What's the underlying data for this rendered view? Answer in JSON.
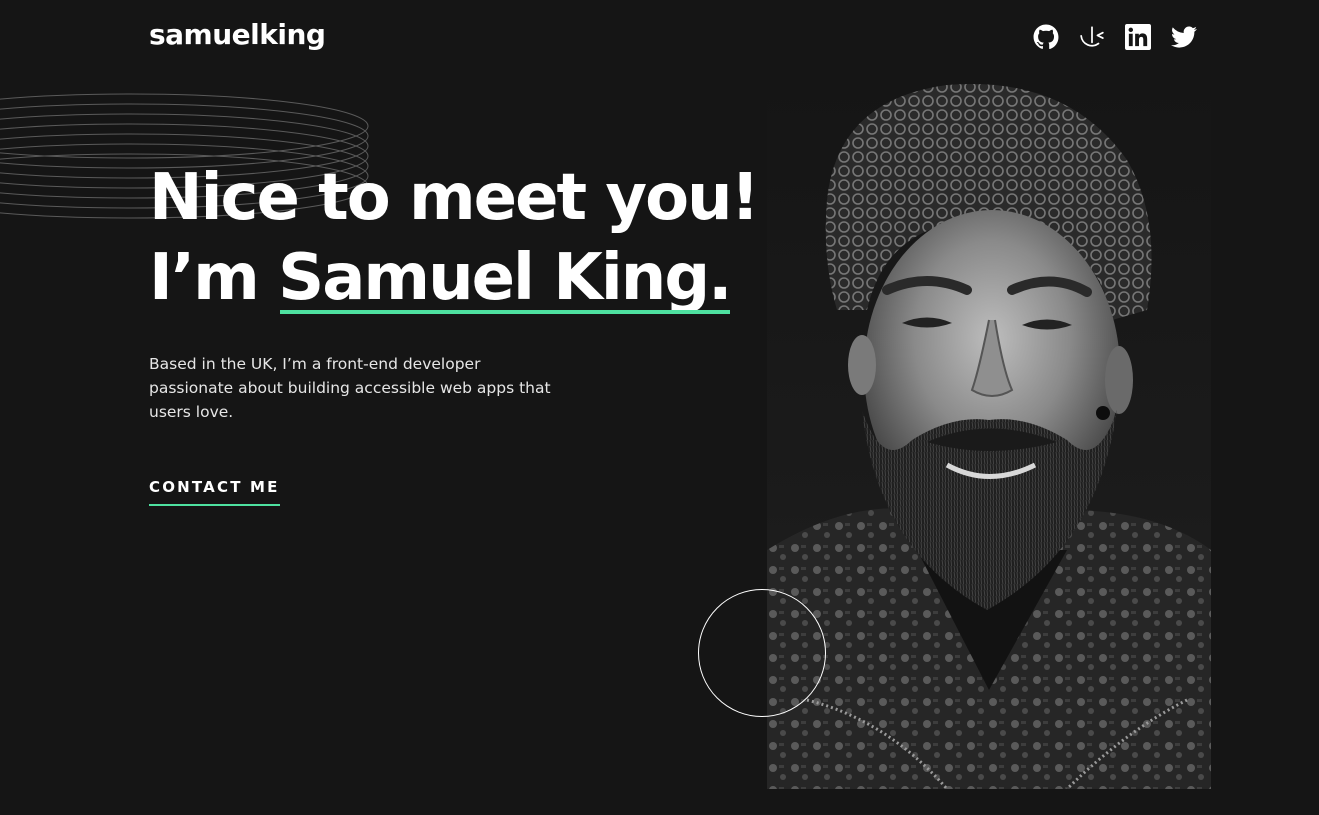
{
  "header": {
    "logo": "samuelking",
    "socials": [
      {
        "name": "github",
        "icon": "github-icon"
      },
      {
        "name": "frontend-mentor",
        "icon": "frontend-mentor-icon"
      },
      {
        "name": "linkedin",
        "icon": "linkedin-icon"
      },
      {
        "name": "twitter",
        "icon": "twitter-icon"
      }
    ]
  },
  "hero": {
    "line1": "Nice to meet you!",
    "line2_prefix": "I’m ",
    "name": "Samuel King.",
    "intro": "Based in the UK, I’m a front-end developer passionate about building accessible web apps that users love.",
    "cta": "CONTACT ME"
  },
  "colors": {
    "background": "#151515",
    "accent": "#4ee1a0",
    "text": "#ffffff"
  },
  "images": {
    "portrait": "grayscale-portrait-photo"
  }
}
